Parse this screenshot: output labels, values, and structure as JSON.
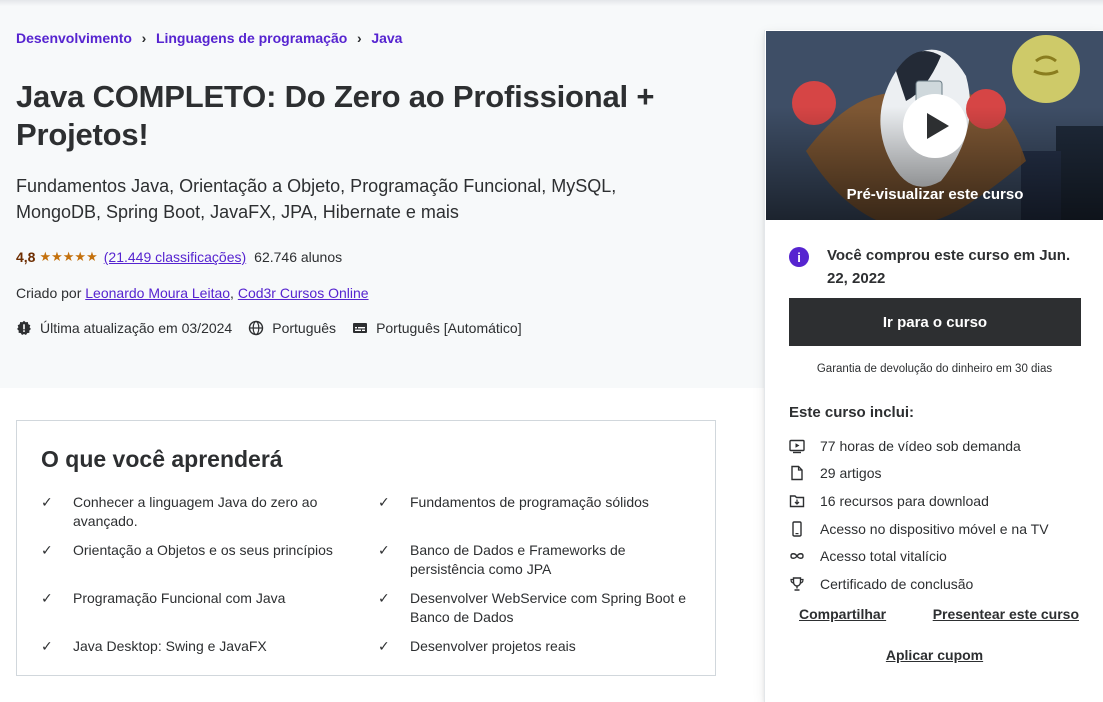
{
  "breadcrumb": [
    "Desenvolvimento",
    "Linguagens de programação",
    "Java"
  ],
  "course": {
    "title": "Java COMPLETO: Do Zero ao Profissional + Projetos!",
    "subtitle": "Fundamentos Java, Orientação a Objeto, Programação Funcional, MySQL, MongoDB, Spring Boot, JavaFX, JPA, Hibernate e mais",
    "rating": "4,8",
    "stars": "★★★★★",
    "ratings_count": "(21.449 classificações)",
    "students": "62.746 alunos",
    "created_by_label": "Criado por",
    "instructors": [
      "Leonardo Moura Leitao",
      "Cod3r Cursos Online"
    ],
    "last_updated": "Última atualização em 03/2024",
    "language": "Português",
    "captions": "Português [Automático]"
  },
  "sidebar": {
    "preview_label": "Pré-visualizar este curso",
    "purchased_text": "Você comprou este curso em Jun. 22, 2022",
    "go_button": "Ir para o curso",
    "guarantee": "Garantia de devolução do dinheiro em 30 dias",
    "includes_title": "Este curso inclui:",
    "includes": [
      {
        "icon": "video-icon",
        "text": "77 horas de vídeo sob demanda"
      },
      {
        "icon": "file-icon",
        "text": "29 artigos"
      },
      {
        "icon": "download-icon",
        "text": "16 recursos para download"
      },
      {
        "icon": "mobile-icon",
        "text": "Acesso no dispositivo móvel e na TV"
      },
      {
        "icon": "infinity-icon",
        "text": "Acesso total vitalício"
      },
      {
        "icon": "trophy-icon",
        "text": "Certificado de conclusão"
      }
    ],
    "share": "Compartilhar",
    "gift": "Presentear este curso",
    "coupon": "Aplicar cupom"
  },
  "learn": {
    "title": "O que você aprenderá",
    "items": [
      "Conhecer a linguagem Java do zero ao avançado.",
      "Fundamentos de programação sólidos",
      "Orientação a Objetos e os seus princípios",
      "Banco de Dados e Frameworks de persistência como JPA",
      "Programação Funcional com Java",
      "Desenvolver WebService com Spring Boot e Banco de Dados",
      "Java Desktop: Swing e JavaFX",
      "Desenvolver projetos reais"
    ]
  },
  "colors": {
    "accent": "#5624d0",
    "dark": "#2d2f31",
    "rating": "#c4710d",
    "hero_bg": "#f7f9fa"
  }
}
